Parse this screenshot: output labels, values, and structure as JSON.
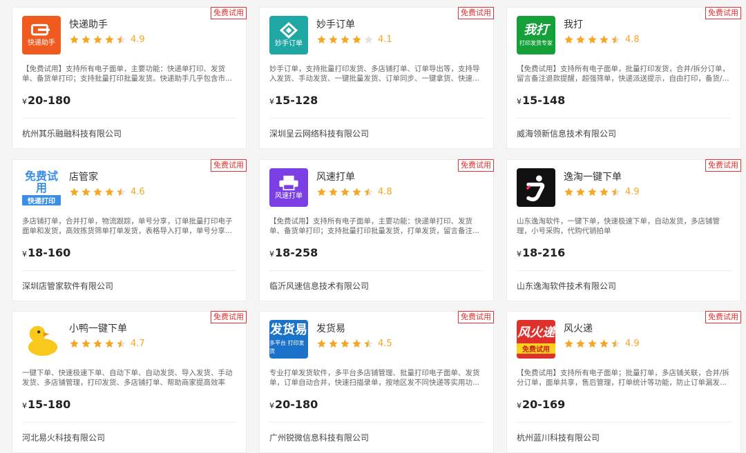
{
  "badge_label": "免费试用",
  "currency": "¥",
  "star_color": "#f5a623",
  "apps": [
    {
      "name": "快递助手",
      "logo_text": "",
      "logo_sub": "快递助手",
      "logo_icon": "chat-box-icon",
      "logo_bg": "#f15a1e",
      "rating": "4.9",
      "stars": 4.5,
      "desc": "【免费试用】支持所有电子面单，主要功能：快递单打印、发货单、备货单打印；支持批量打印批量发货。快递助手几乎包含市...",
      "price": "20-180",
      "company": "杭州其乐融融科技有限公司"
    },
    {
      "name": "妙手订单",
      "logo_text": "◈",
      "logo_sub": "妙手订单",
      "logo_icon": "diamond-logo-icon",
      "logo_bg": "#1fa7a4",
      "rating": "4.1",
      "stars": 4,
      "desc": "妙手订单，支持批量打印发货、多店铺打单、订单导出等，支持导入发货、手动发货、一键批量发货、订单同步、一键拿货、快速...",
      "price": "15-128",
      "company": "深圳呈云网络科技有限公司"
    },
    {
      "name": "我打",
      "logo_text": "我打",
      "logo_sub": "打印发货专家",
      "logo_icon": "wo-da-logo",
      "logo_bg": "#15a03a",
      "rating": "4.8",
      "stars": 4.5,
      "desc": "【免费试用】支持所有电子面单，批量打印发货，合并/拆分订单，留言备注退款提醒，超强筛单，快递派送提示，自由打印，备货/...",
      "price": "15-148",
      "company": "威海领新信息技术有限公司"
    },
    {
      "name": "店管家",
      "logo_text": "免费试用",
      "logo_sub": "快递打印",
      "logo_icon": "dian-guan-jia-logo",
      "logo_bg": "#ffffff",
      "rating": "4.6",
      "stars": 4.5,
      "desc": "多店铺打单，合并打单，物流跟踪，单号分享，订单批量打印电子面单和发货，高效拣货筛单打单发货，表格导入打单，单号分享...",
      "price": "18-160",
      "company": "深圳店管家软件有限公司"
    },
    {
      "name": "风速打单",
      "logo_text": "",
      "logo_sub": "风速打单",
      "logo_icon": "printer-icon",
      "logo_bg": "#7b3fe4",
      "rating": "4.8",
      "stars": 4.5,
      "desc": "【免费试用】支持所有电子面单，主要功能：快递单打印、发货单、备货单打印；支持批量打印批量发货，打单发货，留言备注...",
      "price": "18-258",
      "company": "临沂风速信息技术有限公司"
    },
    {
      "name": "逸淘一键下单",
      "logo_text": "",
      "logo_sub": "",
      "logo_icon": "yi-tao-logo",
      "logo_bg": "#111111",
      "rating": "4.9",
      "stars": 4.5,
      "desc": "山东逸淘软件，一键下单，快速极速下单，自动发货，多店铺管理，小号采购，代购代销拍单",
      "price": "18-216",
      "company": "山东逸淘软件技术有限公司"
    },
    {
      "name": "小鸭一键下单",
      "logo_text": "",
      "logo_sub": "",
      "logo_icon": "duck-icon",
      "logo_bg": "#ffffff",
      "rating": "4.7",
      "stars": 4.5,
      "desc": "一键下单、快速极速下单、自动下单、自动发货、导入发货、手动发货、多店铺管理，打印发货、多店铺打单、帮助商家提高效率",
      "price": "15-180",
      "company": "河北易火科技有限公司"
    },
    {
      "name": "发货易",
      "logo_text": "发货易",
      "logo_sub": "多平台 打印发货",
      "logo_icon": "fa-huo-yi-logo",
      "logo_bg": "#1a73c9",
      "rating": "4.5",
      "stars": 4.5,
      "desc": "专业打单发货软件，多平台多店铺管理、批量打印电子面单、发货单，订单自动合并，快速扫描录单，按地区发不同快递等实用功...",
      "price": "20-180",
      "company": "广州锐微信息科技有限公司"
    },
    {
      "name": "风火递",
      "logo_text": "风火递",
      "logo_sub": "免费试用",
      "logo_icon": "feng-huo-di-logo",
      "logo_bg": "#e0302b",
      "rating": "4.9",
      "stars": 4.5,
      "desc": "【免费试用】支持所有电子面单；批量打单，多店铺关联，合并/拆分订单，面单共享，售后管理，打单统计等功能，防止订单漏发...",
      "price": "20-169",
      "company": "杭州蓝川科技有限公司"
    }
  ]
}
